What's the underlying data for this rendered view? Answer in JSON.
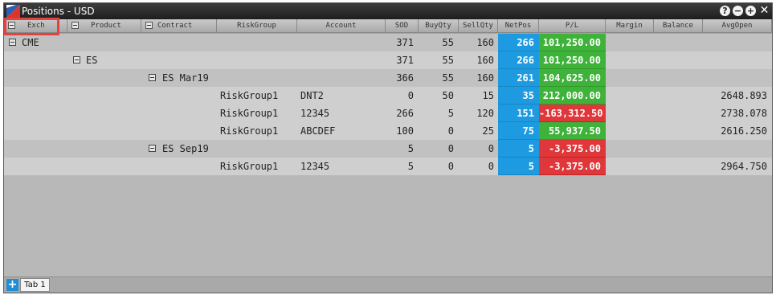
{
  "window": {
    "title": "Positions - USD"
  },
  "title_buttons": {
    "help": "?",
    "minimize": "−",
    "add": "+",
    "close": "✕"
  },
  "columns": {
    "exch": "Exch",
    "product": "Product",
    "contract": "Contract",
    "riskgroup": "RiskGroup",
    "account": "Account",
    "sod": "SOD",
    "buyqty": "BuyQty",
    "sellqty": "SellQty",
    "netpos": "NetPos",
    "pl": "P/L",
    "margin": "Margin",
    "balance": "Balance",
    "avgopen": "AvgOpen"
  },
  "rows": [
    {
      "exch": "CME",
      "product": "",
      "contract": "",
      "riskgroup": "",
      "account": "",
      "sod": "371",
      "buyqty": "55",
      "sellqty": "160",
      "netpos": "266",
      "pl": "101,250.00",
      "avgopen": ""
    },
    {
      "exch": "",
      "product": "ES",
      "contract": "",
      "riskgroup": "",
      "account": "",
      "sod": "371",
      "buyqty": "55",
      "sellqty": "160",
      "netpos": "266",
      "pl": "101,250.00",
      "avgopen": ""
    },
    {
      "exch": "",
      "product": "",
      "contract": "ES Mar19",
      "riskgroup": "",
      "account": "",
      "sod": "366",
      "buyqty": "55",
      "sellqty": "160",
      "netpos": "261",
      "pl": "104,625.00",
      "avgopen": ""
    },
    {
      "exch": "",
      "product": "",
      "contract": "",
      "riskgroup": "RiskGroup1",
      "account": "DNT2",
      "sod": "0",
      "buyqty": "50",
      "sellqty": "15",
      "netpos": "35",
      "pl": "212,000.00",
      "avgopen": "2648.893"
    },
    {
      "exch": "",
      "product": "",
      "contract": "",
      "riskgroup": "RiskGroup1",
      "account": "12345",
      "sod": "266",
      "buyqty": "5",
      "sellqty": "120",
      "netpos": "151",
      "pl": "-163,312.50",
      "avgopen": "2738.078"
    },
    {
      "exch": "",
      "product": "",
      "contract": "",
      "riskgroup": "RiskGroup1",
      "account": "ABCDEF",
      "sod": "100",
      "buyqty": "0",
      "sellqty": "25",
      "netpos": "75",
      "pl": "55,937.50",
      "avgopen": "2616.250"
    },
    {
      "exch": "",
      "product": "",
      "contract": "ES Sep19",
      "riskgroup": "",
      "account": "",
      "sod": "5",
      "buyqty": "0",
      "sellqty": "0",
      "netpos": "5",
      "pl": "-3,375.00",
      "avgopen": ""
    },
    {
      "exch": "",
      "product": "",
      "contract": "",
      "riskgroup": "RiskGroup1",
      "account": "12345",
      "sod": "5",
      "buyqty": "0",
      "sellqty": "0",
      "netpos": "5",
      "pl": "-3,375.00",
      "avgopen": "2964.750"
    }
  ],
  "colors": {
    "netpos": "#1d9ae0",
    "pl_positive": "#3fb23a",
    "pl_negative": "#e0373a",
    "highlight": "#e4423e"
  },
  "tabs": {
    "add": "+",
    "tab1": "Tab 1"
  }
}
